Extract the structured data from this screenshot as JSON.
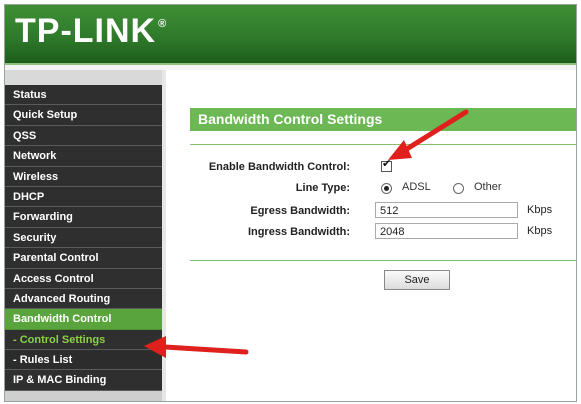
{
  "brand": {
    "logo": "TP-LINK",
    "reg": "®"
  },
  "sidebar": {
    "items": [
      {
        "label": "Status",
        "type": "main"
      },
      {
        "label": "Quick Setup",
        "type": "main"
      },
      {
        "label": "QSS",
        "type": "main"
      },
      {
        "label": "Network",
        "type": "main"
      },
      {
        "label": "Wireless",
        "type": "main"
      },
      {
        "label": "DHCP",
        "type": "main"
      },
      {
        "label": "Forwarding",
        "type": "main"
      },
      {
        "label": "Security",
        "type": "main"
      },
      {
        "label": "Parental Control",
        "type": "main"
      },
      {
        "label": "Access Control",
        "type": "main"
      },
      {
        "label": "Advanced Routing",
        "type": "main"
      },
      {
        "label": "Bandwidth Control",
        "type": "active"
      },
      {
        "label": "- Control Settings",
        "type": "sub-active"
      },
      {
        "label": "- Rules List",
        "type": "sub"
      },
      {
        "label": "IP & MAC Binding",
        "type": "main"
      }
    ]
  },
  "main": {
    "title": "Bandwidth Control Settings",
    "enable_label": "Enable Bandwidth Control:",
    "enable_checked": true,
    "line_type_label": "Line Type:",
    "line_type_options": [
      "ADSL",
      "Other"
    ],
    "line_type_selected": "ADSL",
    "egress_label": "Egress Bandwidth:",
    "egress_value": "512",
    "ingress_label": "Ingress Bandwidth:",
    "ingress_value": "2048",
    "unit": "Kbps",
    "save_label": "Save"
  },
  "colors": {
    "header_green": "#2f7a2b",
    "title_green": "#6cb854",
    "menu_dark": "#2f2f2f",
    "menu_active": "#59a43d",
    "sub_active_text": "#8ad241",
    "arrow_red": "#e0201c"
  },
  "icons": [
    "checkmark-icon",
    "radio-icon",
    "red-arrow-icon"
  ]
}
